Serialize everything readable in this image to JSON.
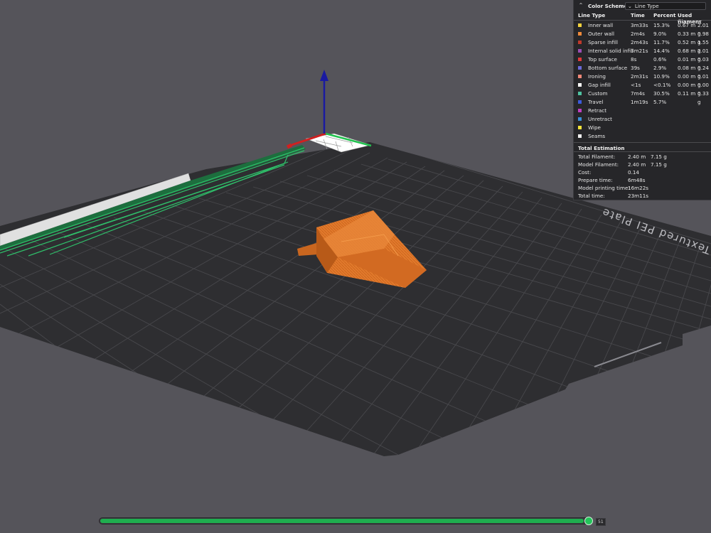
{
  "plate": {
    "name": "Textured PEI Plate"
  },
  "legend": {
    "title": "Color Scheme",
    "scheme_value": "Line Type",
    "headers": {
      "line_type": "Line Type",
      "time": "Time",
      "percent": "Percent",
      "used_filament": "Used filament"
    },
    "rows": [
      {
        "name": "Inner wall",
        "color": "#f3d23e",
        "time": "3m33s",
        "percent": "15.3%",
        "length": "0.67 m",
        "weight": "2.01 g"
      },
      {
        "name": "Outer wall",
        "color": "#ef8a3a",
        "time": "2m4s",
        "percent": "9.0%",
        "length": "0.33 m",
        "weight": "0.98 g"
      },
      {
        "name": "Sparse infill",
        "color": "#c0392b",
        "time": "2m43s",
        "percent": "11.7%",
        "length": "0.52 m",
        "weight": "1.55 g"
      },
      {
        "name": "Internal solid infill",
        "color": "#9b4fb5",
        "time": "3m21s",
        "percent": "14.4%",
        "length": "0.68 m",
        "weight": "2.01 g"
      },
      {
        "name": "Top surface",
        "color": "#e03a3a",
        "time": "8s",
        "percent": "0.6%",
        "length": "0.01 m",
        "weight": "0.03 g"
      },
      {
        "name": "Bottom surface",
        "color": "#6a6ad8",
        "time": "39s",
        "percent": "2.9%",
        "length": "0.08 m",
        "weight": "0.24 g"
      },
      {
        "name": "Ironing",
        "color": "#f08878",
        "time": "2m31s",
        "percent": "10.9%",
        "length": "0.00 m",
        "weight": "0.01 g"
      },
      {
        "name": "Gap infill",
        "color": "#ffffff",
        "time": "<1s",
        "percent": "<0.1%",
        "length": "0.00 m",
        "weight": "0.00 g"
      },
      {
        "name": "Custom",
        "color": "#4fc3a1",
        "time": "7m4s",
        "percent": "30.5%",
        "length": "0.11 m",
        "weight": "0.33 g"
      },
      {
        "name": "Travel",
        "color": "#3b5bdb",
        "time": "1m19s",
        "percent": "5.7%",
        "length": "",
        "weight": ""
      },
      {
        "name": "Retract",
        "color": "#c040c0",
        "time": "",
        "percent": "",
        "length": "",
        "weight": ""
      },
      {
        "name": "Unretract",
        "color": "#3a8fd6",
        "time": "",
        "percent": "",
        "length": "",
        "weight": ""
      },
      {
        "name": "Wipe",
        "color": "#f5e43a",
        "time": "",
        "percent": "",
        "length": "",
        "weight": ""
      },
      {
        "name": "Seams",
        "color": "#f0f0f0",
        "time": "",
        "percent": "",
        "length": "",
        "weight": ""
      }
    ],
    "total": {
      "title": "Total Estimation",
      "rows": [
        {
          "label": "Total Filament:",
          "v1": "2.40 m",
          "v2": "7.15 g"
        },
        {
          "label": "Model Filament:",
          "v1": "2.40 m",
          "v2": "7.15 g"
        },
        {
          "label": "Cost:",
          "v1": "0.14",
          "v2": ""
        },
        {
          "label": "Prepare time:",
          "v1": "6m48s",
          "v2": ""
        },
        {
          "label": "Model printing time:",
          "v1": "16m22s",
          "v2": ""
        },
        {
          "label": "Total time:",
          "v1": "23m11s",
          "v2": ""
        }
      ]
    }
  },
  "slider": {
    "progress": 0.99,
    "label": "51"
  },
  "colors": {
    "accent_green": "#1fae4f",
    "model_orange": "#e0782a",
    "axis_z": "#1a1aa0",
    "axis_x": "#d02020"
  }
}
